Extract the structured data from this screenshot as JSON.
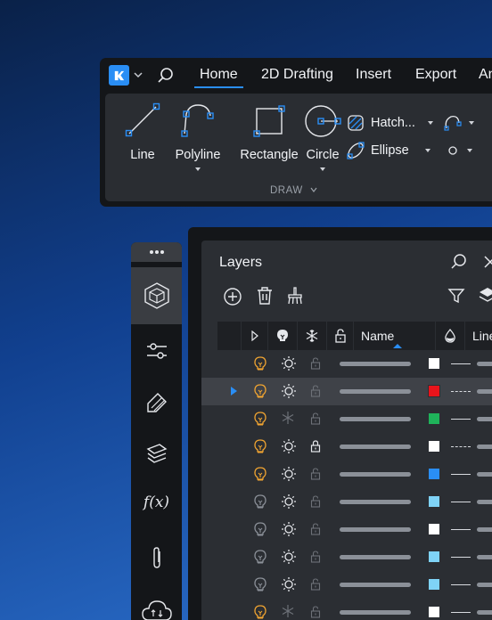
{
  "ribbon": {
    "tabs": [
      {
        "label": "Home",
        "active": true
      },
      {
        "label": "2D Drafting",
        "active": false
      },
      {
        "label": "Insert",
        "active": false
      },
      {
        "label": "Export",
        "active": false
      },
      {
        "label": "An",
        "active": false
      }
    ],
    "tools": {
      "line": "Line",
      "polyline": "Polyline",
      "rectangle": "Rectangle",
      "circle": "Circle",
      "hatch": "Hatch...",
      "ellipse": "Ellipse"
    },
    "group_label": "DRAW",
    "accent": "#2a8ef5"
  },
  "layers": {
    "title": "Layers",
    "columns": {
      "name": "Name",
      "linetype": "Linety"
    },
    "rows": [
      {
        "bulb": "on",
        "freeze": "thawed",
        "lock": "unlocked",
        "color": "#ffffff",
        "linetype": "solid",
        "selected": false
      },
      {
        "bulb": "on",
        "freeze": "thawed",
        "lock": "unlocked",
        "color": "#e8141b",
        "linetype": "dashed",
        "selected": true
      },
      {
        "bulb": "on",
        "freeze": "frozen",
        "lock": "unlocked",
        "color": "#1fb35a",
        "linetype": "solid",
        "selected": false
      },
      {
        "bulb": "on",
        "freeze": "thawed",
        "lock": "locked",
        "color": "#ffffff",
        "linetype": "dashed",
        "selected": false
      },
      {
        "bulb": "on",
        "freeze": "thawed",
        "lock": "unlocked",
        "color": "#2a8ef5",
        "linetype": "solid",
        "selected": false
      },
      {
        "bulb": "off",
        "freeze": "thawed",
        "lock": "unlocked",
        "color": "#7fd3f7",
        "linetype": "solid",
        "selected": false
      },
      {
        "bulb": "off",
        "freeze": "thawed",
        "lock": "unlocked",
        "color": "#ffffff",
        "linetype": "solid",
        "selected": false
      },
      {
        "bulb": "off",
        "freeze": "thawed",
        "lock": "unlocked",
        "color": "#7fd3f7",
        "linetype": "solid",
        "selected": false
      },
      {
        "bulb": "off",
        "freeze": "thawed",
        "lock": "unlocked",
        "color": "#7fd3f7",
        "linetype": "solid",
        "selected": false
      },
      {
        "bulb": "on",
        "freeze": "frozen",
        "lock": "unlocked",
        "color": "#ffffff",
        "linetype": "solid",
        "selected": false
      }
    ]
  },
  "sidebar": {
    "items": [
      "3d-model-icon",
      "sliders-icon",
      "draw-edit-icon",
      "layers-stack-icon",
      "function-icon",
      "paperclip-icon",
      "cloud-sync-icon"
    ],
    "function_glyph": "f(x)"
  },
  "colors": {
    "bulb_on": "#f0a431",
    "bulb_off": "#8b9098",
    "selection": "#2a8ef5"
  }
}
